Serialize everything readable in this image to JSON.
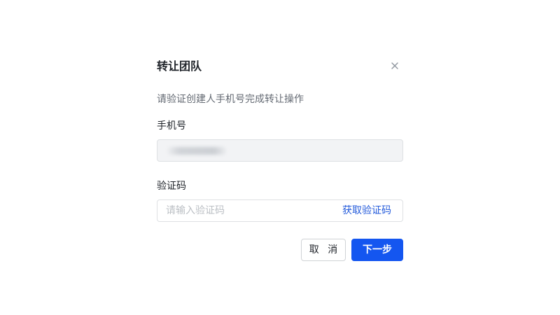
{
  "dialog": {
    "title": "转让团队",
    "description": "请验证创建人手机号完成转让操作"
  },
  "phone": {
    "label": "手机号",
    "value_masked": true
  },
  "code": {
    "label": "验证码",
    "placeholder": "请输入验证码",
    "value": "",
    "get_code_label": "获取验证码"
  },
  "actions": {
    "cancel_label": "取 消",
    "next_label": "下一步"
  },
  "icons": {
    "close": "close-icon"
  },
  "colors": {
    "primary": "#1456f0",
    "link": "#245bdb",
    "text": "#1f2329",
    "secondary_text": "#646a73",
    "placeholder": "#bbbfc4",
    "border": "#dee0e3",
    "disabled_bg": "#f2f3f5"
  }
}
